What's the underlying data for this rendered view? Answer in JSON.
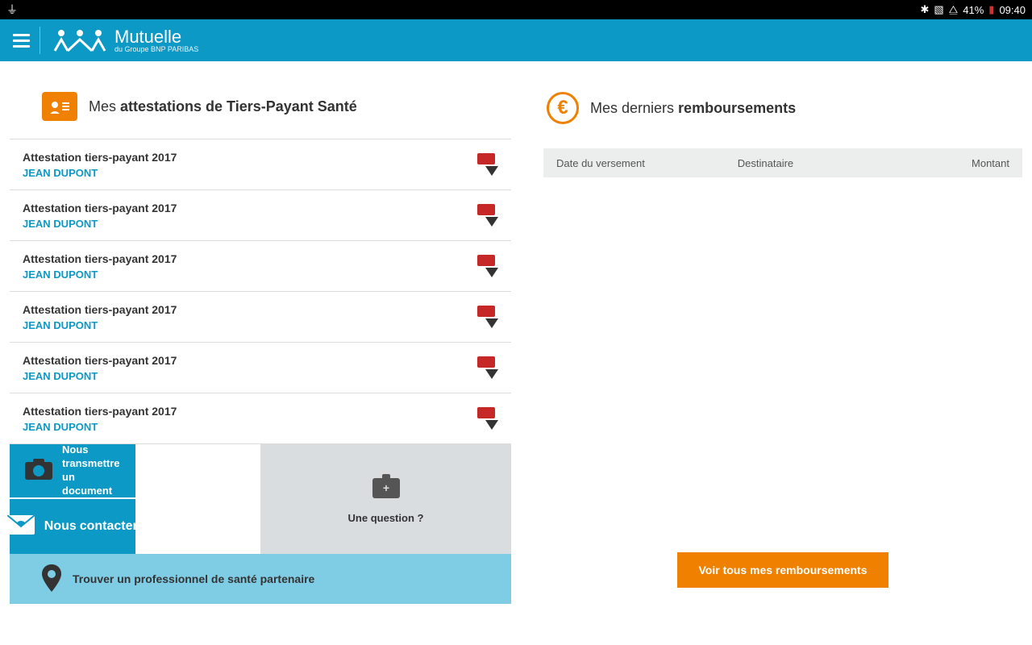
{
  "status": {
    "battery_pct": "41%",
    "time": "09:40"
  },
  "header": {
    "brand_main": "Mutuelle",
    "brand_sub": "du Groupe BNP PARIBAS"
  },
  "attestations": {
    "title_prefix": "Mes ",
    "title_bold": "attestations de Tiers-Payant Santé",
    "items": [
      {
        "title": "Attestation tiers-payant 2017",
        "name": "JEAN DUPONT"
      },
      {
        "title": "Attestation tiers-payant 2017",
        "name": "JEAN DUPONT"
      },
      {
        "title": "Attestation tiers-payant 2017",
        "name": "JEAN DUPONT"
      },
      {
        "title": "Attestation tiers-payant 2017",
        "name": "JEAN DUPONT"
      },
      {
        "title": "Attestation tiers-payant 2017",
        "name": "JEAN DUPONT"
      },
      {
        "title": "Attestation tiers-payant 2017",
        "name": "JEAN DUPONT"
      }
    ]
  },
  "actions": {
    "transmit_line1": "Nous transmettre",
    "transmit_line2_prefix": "un ",
    "transmit_line2_bold": "document",
    "contact_prefix": "Nous ",
    "contact_bold": "contacter",
    "question": "Une question ?",
    "find_prefix": "Trouver ",
    "find_bold": "un professionnel de santé partenaire"
  },
  "remb": {
    "title_prefix": "Mes derniers ",
    "title_bold": "remboursements",
    "col1": "Date du versement",
    "col2": "Destinataire",
    "col3": "Montant",
    "button": "Voir tous mes remboursements"
  }
}
